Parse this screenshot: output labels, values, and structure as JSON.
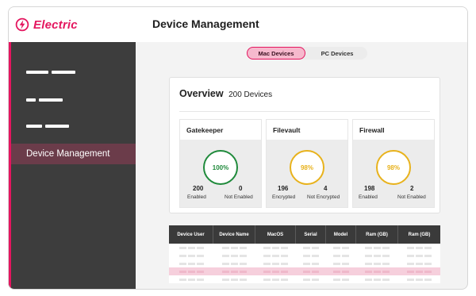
{
  "app": {
    "name": "Electric",
    "brand_color": "#e4165f",
    "logo_icon": "lightning-bolt-icon"
  },
  "header": {
    "title": "Device Management"
  },
  "sidebar": {
    "items": [
      {
        "label": ""
      },
      {
        "label": ""
      },
      {
        "label": ""
      },
      {
        "label": "Device Management",
        "active": true
      }
    ]
  },
  "toggle": {
    "options": [
      "Mac Devices",
      "PC Devices"
    ],
    "selected": "Mac Devices"
  },
  "overview": {
    "title": "Overview",
    "count": "200 Devices",
    "cards": [
      {
        "title": "Gatekeeper",
        "percent": "100%",
        "status_color": "#1f8a3b",
        "left_value": "200",
        "left_label": "Enabled",
        "right_value": "0",
        "right_label": "Not Enabled"
      },
      {
        "title": "Filevault",
        "percent": "98%",
        "status_color": "#e8b21c",
        "left_value": "196",
        "left_label": "Encrypted",
        "right_value": "4",
        "right_label": "Not Encrypted"
      },
      {
        "title": "Firewall",
        "percent": "98%",
        "status_color": "#e8b21c",
        "left_value": "198",
        "left_label": "Enabled",
        "right_value": "2",
        "right_label": "Not Enabled"
      }
    ]
  },
  "table": {
    "columns": [
      "Device User",
      "Device Name",
      "MacOS",
      "Serial",
      "Model",
      "Ram (GB)",
      "Ram (GB)"
    ],
    "row_colors": [
      "#ffffff",
      "#f6cfdc"
    ]
  }
}
